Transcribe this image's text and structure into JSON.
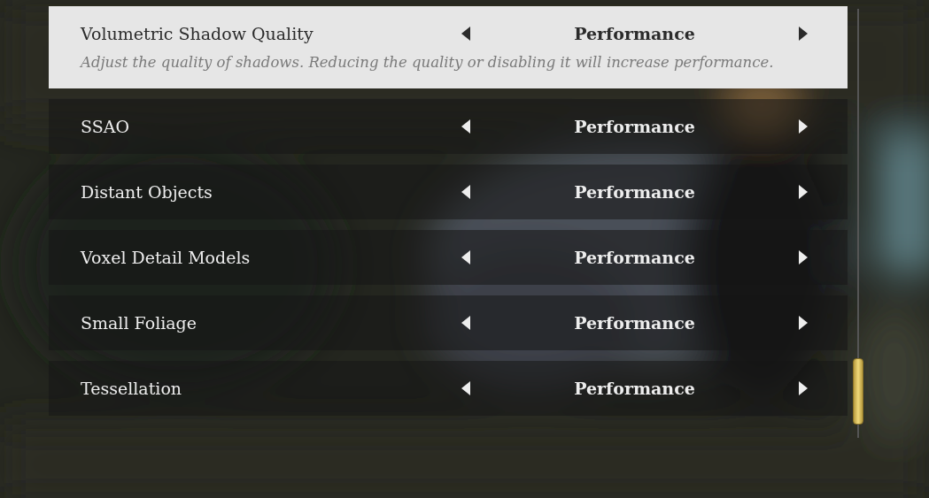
{
  "settings": [
    {
      "label": "Volumetric Shadow Quality",
      "value": "Performance",
      "selected": true,
      "description": "Adjust the quality of shadows. Reducing the quality or disabling it will increase performance."
    },
    {
      "label": "SSAO",
      "value": "Performance",
      "selected": false
    },
    {
      "label": "Distant Objects",
      "value": "Performance",
      "selected": false
    },
    {
      "label": "Voxel Detail Models",
      "value": "Performance",
      "selected": false
    },
    {
      "label": "Small Foliage",
      "value": "Performance",
      "selected": false
    },
    {
      "label": "Tessellation",
      "value": "Performance",
      "selected": false
    }
  ]
}
